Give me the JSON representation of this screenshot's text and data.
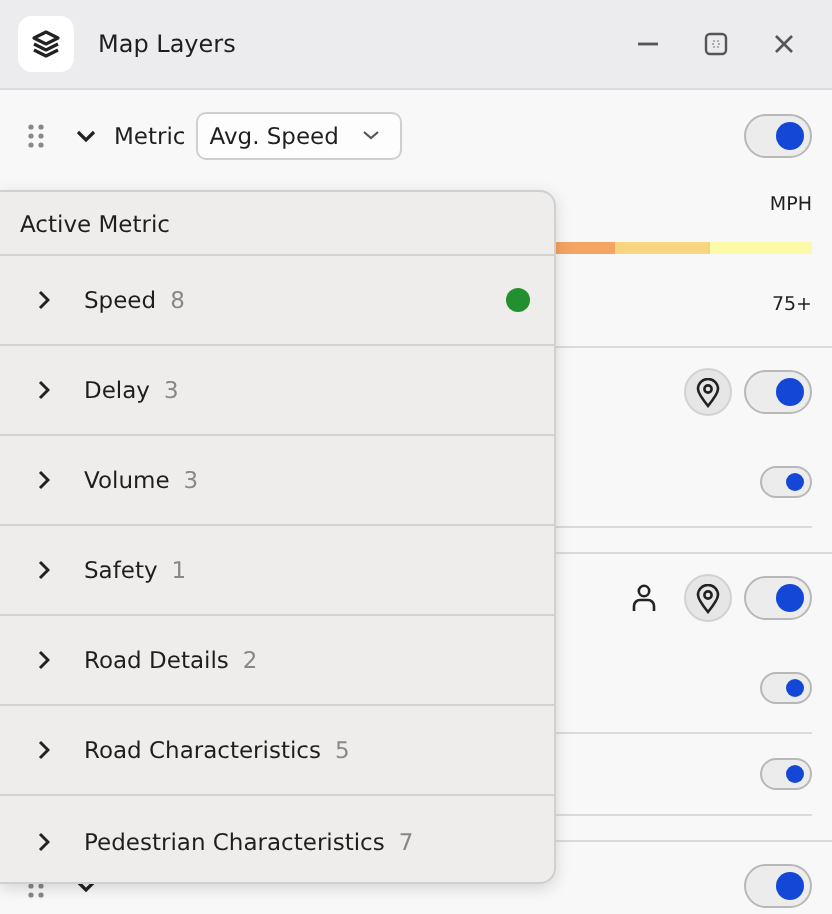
{
  "window": {
    "title": "Map Layers"
  },
  "layers": [
    {
      "kind": "metric",
      "label": "Metric",
      "value": "Avg. Speed",
      "on": true
    },
    {
      "kind": "legend",
      "unit": "MPH",
      "max": "75+"
    },
    {
      "kind": "layer",
      "person": false,
      "pin": true,
      "on": true
    },
    {
      "kind": "sublayer",
      "on": true
    },
    {
      "kind": "layer",
      "person": true,
      "pin": true,
      "on": true
    },
    {
      "kind": "sublayer",
      "on": true
    },
    {
      "kind": "sublayer",
      "on": true
    },
    {
      "kind": "heatmap",
      "on": true
    }
  ],
  "popup": {
    "title": "Active Metric",
    "items": [
      {
        "label": "Speed",
        "count": "8",
        "selected": true
      },
      {
        "label": "Delay",
        "count": "3",
        "selected": false
      },
      {
        "label": "Volume",
        "count": "3",
        "selected": false
      },
      {
        "label": "Safety",
        "count": "1",
        "selected": false
      },
      {
        "label": "Road Details",
        "count": "2",
        "selected": false
      },
      {
        "label": "Road Characteristics",
        "count": "5",
        "selected": false
      },
      {
        "label": "Pedestrian Characteristics",
        "count": "7",
        "selected": false
      }
    ]
  }
}
